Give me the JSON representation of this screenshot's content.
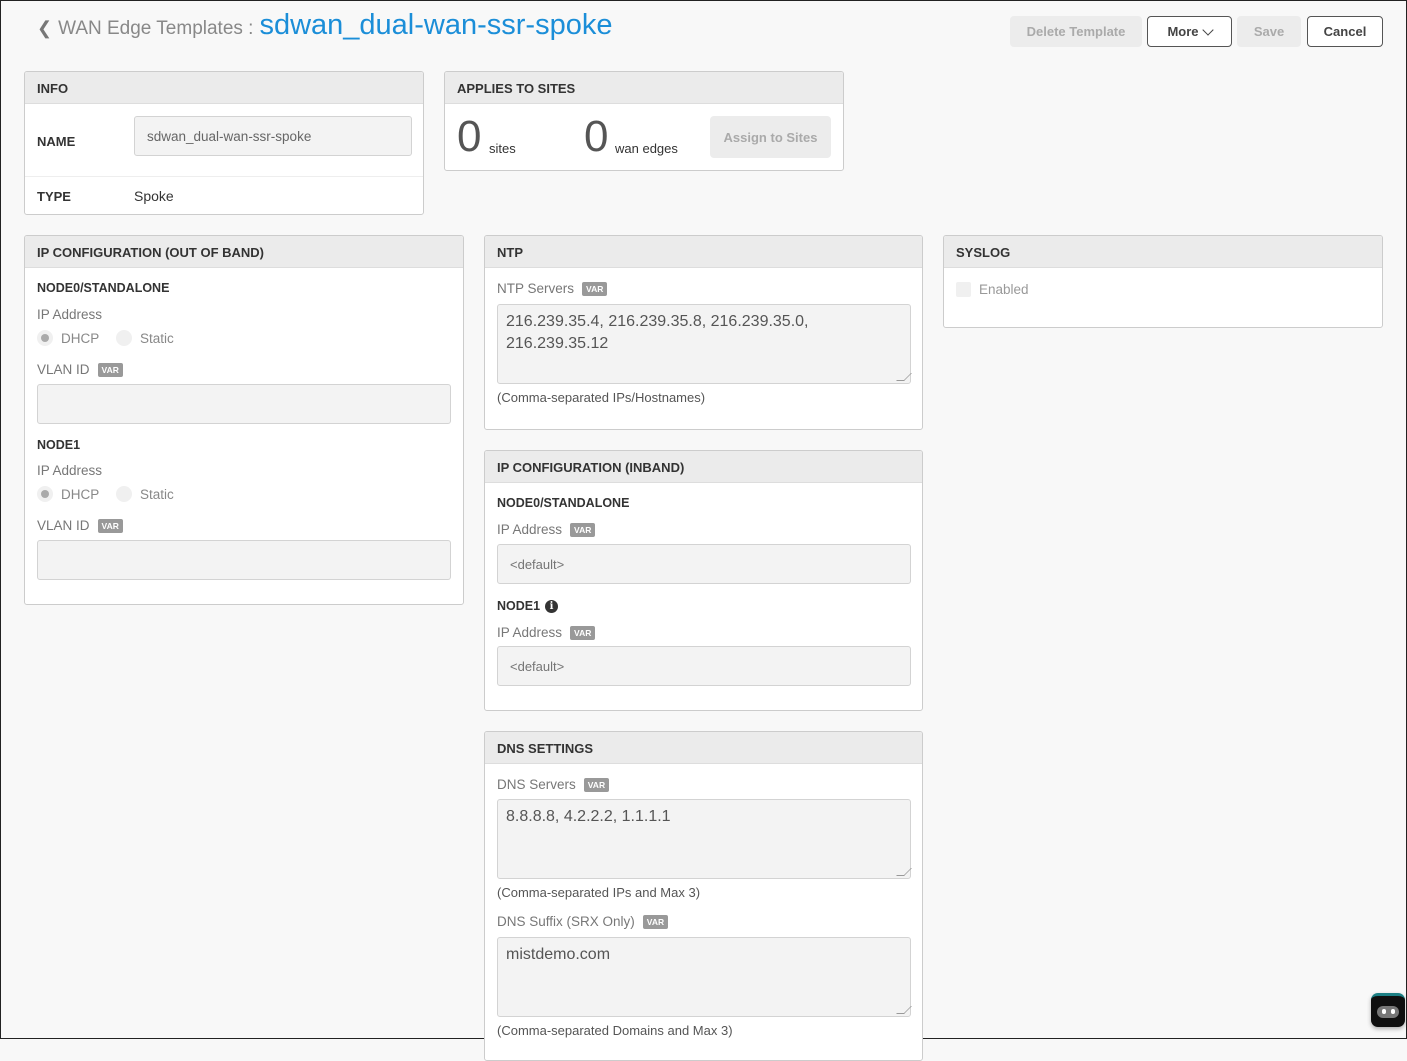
{
  "header": {
    "breadcrumb": "WAN Edge Templates :",
    "template_name": "sdwan_dual-wan-ssr-spoke",
    "buttons": {
      "delete": "Delete Template",
      "more": "More",
      "save": "Save",
      "cancel": "Cancel"
    }
  },
  "info": {
    "title": "INFO",
    "name_label": "NAME",
    "name_value": "sdwan_dual-wan-ssr-spoke",
    "type_label": "TYPE",
    "type_value": "Spoke"
  },
  "applies": {
    "title": "APPLIES TO SITES",
    "sites_count": "0",
    "sites_label": "sites",
    "edges_count": "0",
    "edges_label": "wan edges",
    "assign": "Assign to Sites"
  },
  "oob": {
    "title": "IP CONFIGURATION (OUT OF BAND)",
    "node0": {
      "title": "NODE0/STANDALONE",
      "ip_label": "IP Address",
      "dhcp": "DHCP",
      "static": "Static",
      "vlan_label": "VLAN ID",
      "vlan_value": ""
    },
    "node1": {
      "title": "NODE1",
      "ip_label": "IP Address",
      "dhcp": "DHCP",
      "static": "Static",
      "vlan_label": "VLAN ID",
      "vlan_value": ""
    }
  },
  "var_badge": "VAR",
  "ntp": {
    "title": "NTP",
    "servers_label": "NTP Servers",
    "servers_value": "216.239.35.4, 216.239.35.8, 216.239.35.0, 216.239.35.12",
    "hint": "(Comma-separated IPs/Hostnames)"
  },
  "inband": {
    "title": "IP CONFIGURATION (INBAND)",
    "node0": {
      "title": "NODE0/STANDALONE",
      "ip_label": "IP Address",
      "placeholder": "<default>"
    },
    "node1": {
      "title": "NODE1",
      "ip_label": "IP Address",
      "placeholder": "<default>"
    }
  },
  "dns": {
    "title": "DNS SETTINGS",
    "servers_label": "DNS Servers",
    "servers_value": "8.8.8.8, 4.2.2.2, 1.1.1.1",
    "servers_hint": "(Comma-separated IPs and Max 3)",
    "suffix_label": "DNS Suffix (SRX Only)",
    "suffix_value": "mistdemo.com",
    "suffix_hint": "(Comma-separated Domains and Max 3)"
  },
  "syslog": {
    "title": "SYSLOG",
    "enabled_label": "Enabled"
  }
}
